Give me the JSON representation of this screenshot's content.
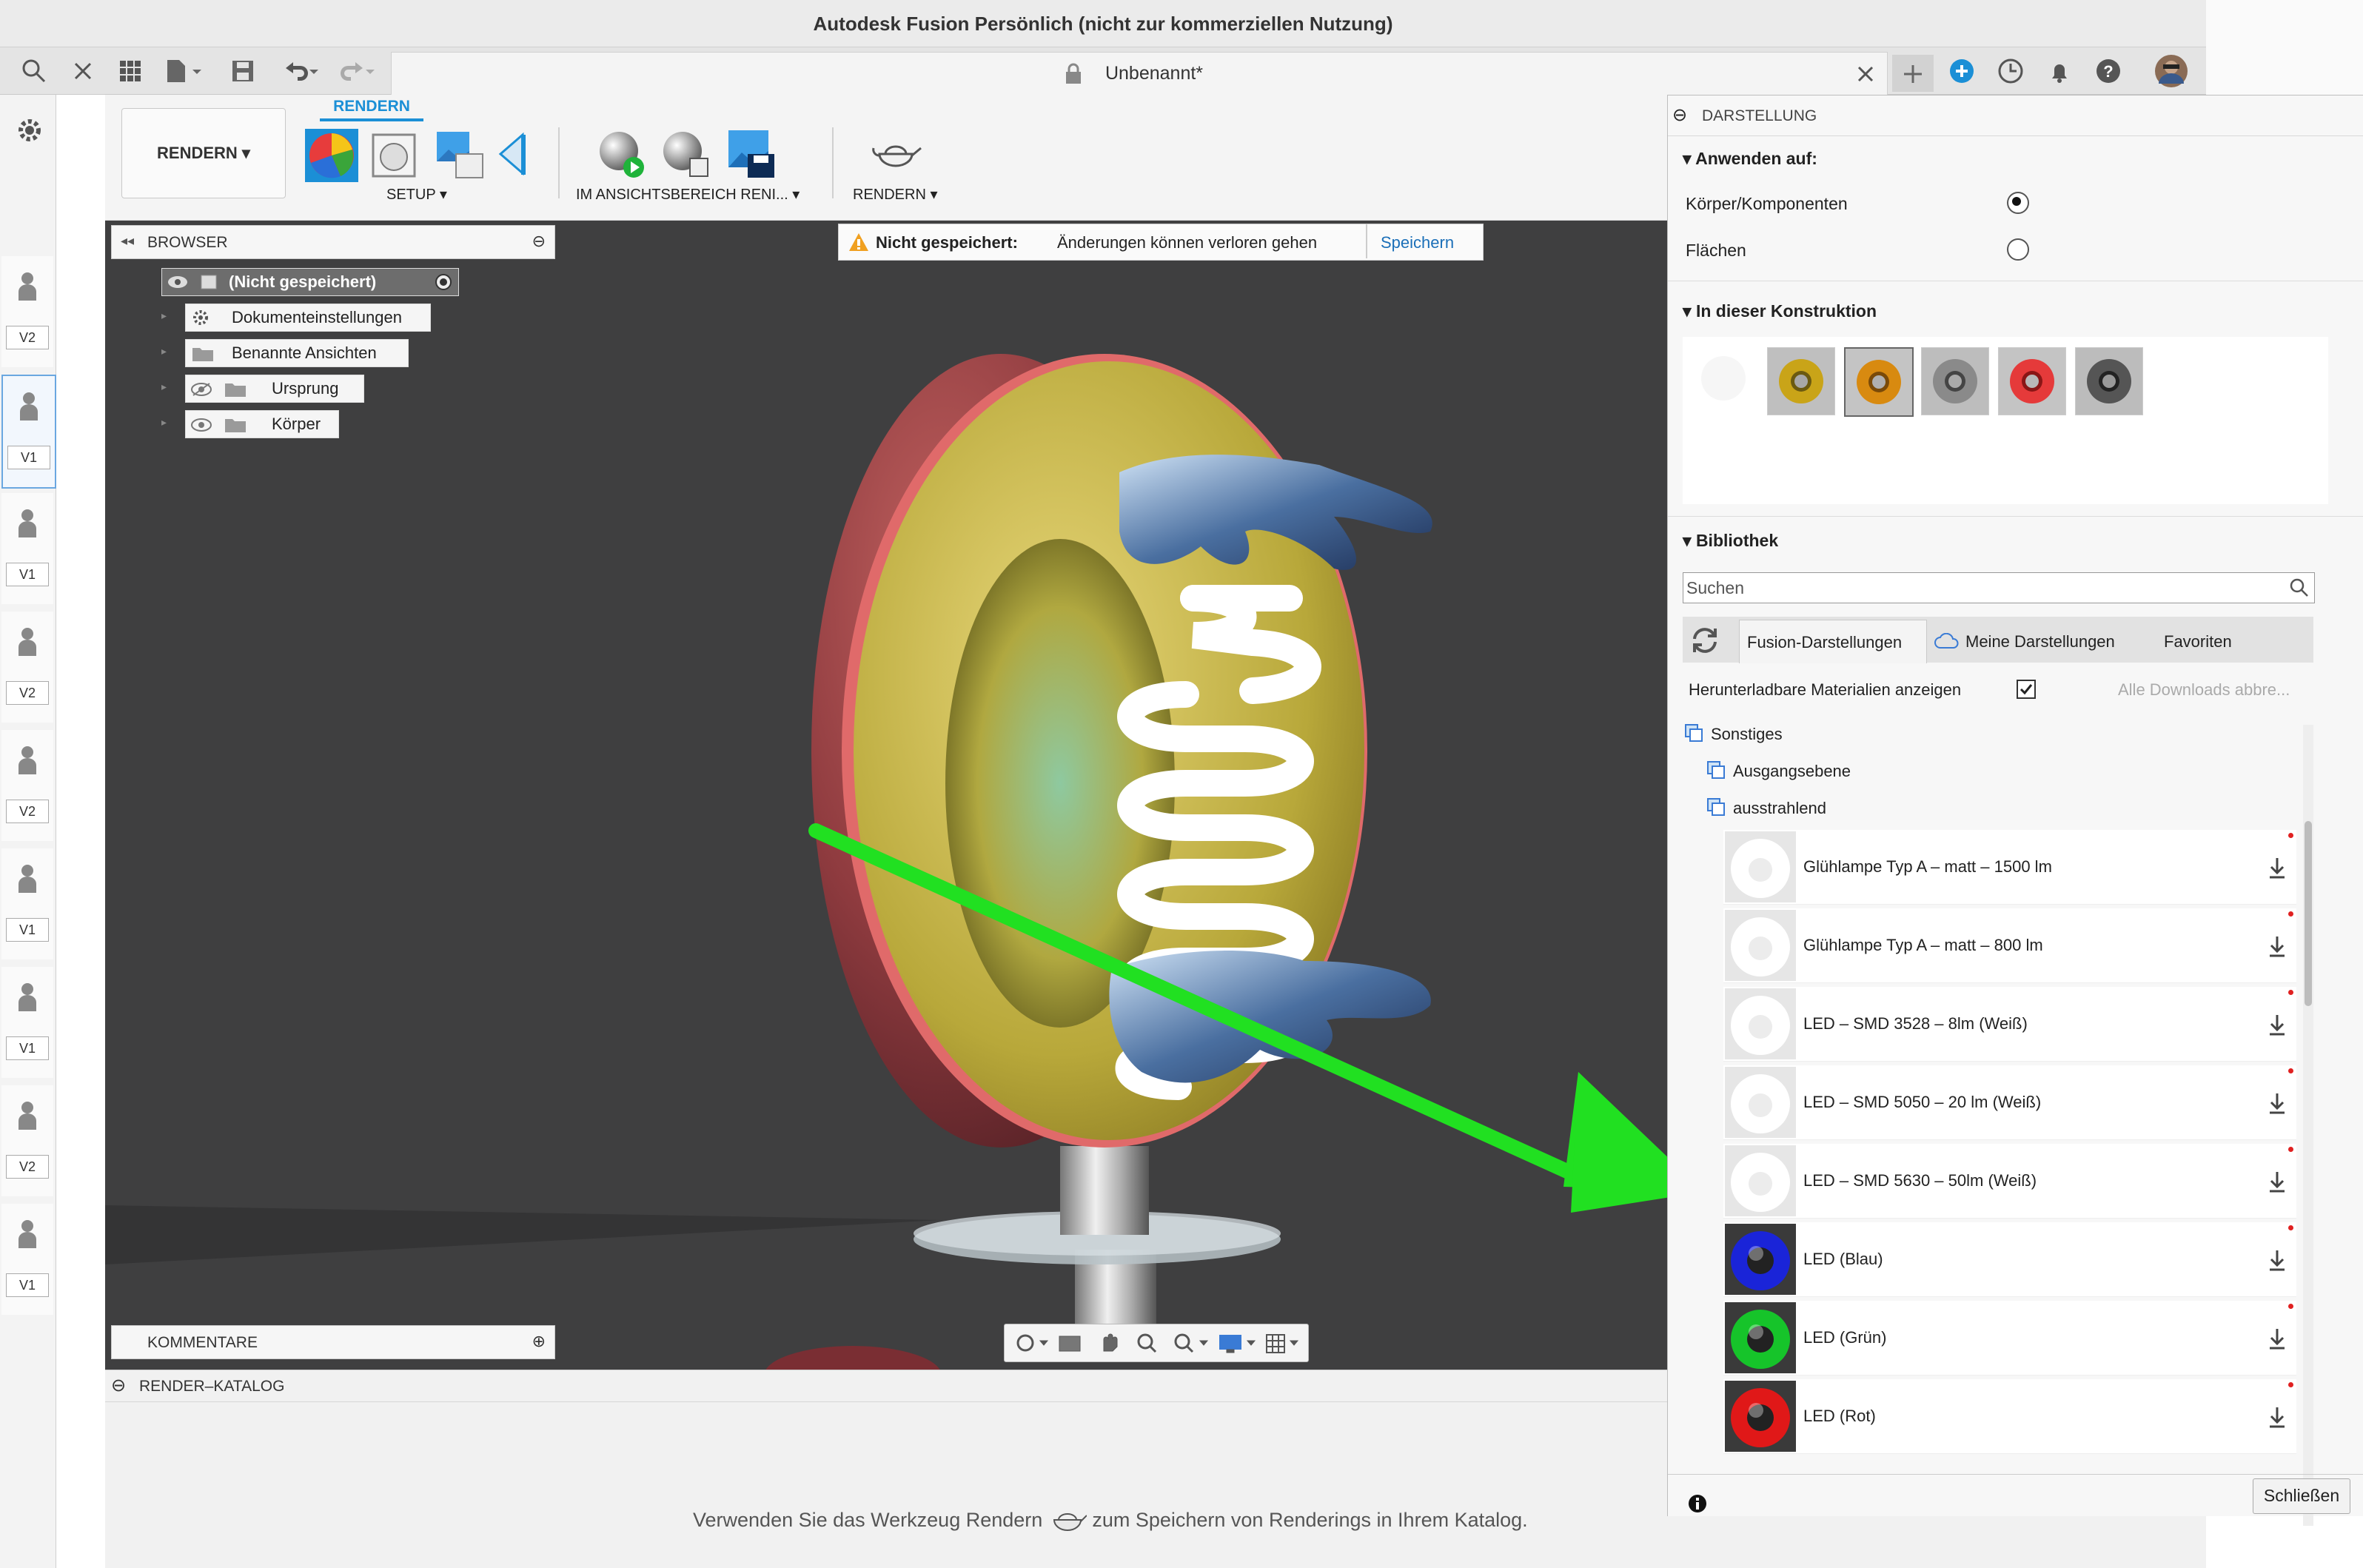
{
  "app": {
    "title": "Autodesk Fusion Persönlich (nicht zur kommerziellen Nutzung)"
  },
  "toolbar": {
    "doc_tab": "Unbenannt*",
    "icons": [
      "search-icon",
      "close-icon",
      "apps-grid-icon",
      "file-icon",
      "save-icon",
      "undo-icon",
      "redo-icon",
      "new-tab-icon",
      "extensions-icon",
      "job-status-icon",
      "notifications-icon",
      "help-icon",
      "user-avatar"
    ]
  },
  "versions": [
    "V2",
    "V1",
    "V1",
    "V2",
    "V2",
    "V1",
    "V1",
    "V2",
    "V1"
  ],
  "ribbon": {
    "workspace": "RENDERN",
    "tab": "RENDERN",
    "groups": {
      "setup": "SETUP",
      "in_canvas": "IM ANSICHTSBEREICH RENI...",
      "render": "RENDERN"
    }
  },
  "browser": {
    "title": "BROWSER",
    "root": "(Nicht gespeichert)",
    "nodes": [
      "Dokumenteinstellungen",
      "Benannte Ansichten",
      "Ursprung",
      "Körper"
    ]
  },
  "warning": {
    "label": "Nicht gespeichert:",
    "message": "Änderungen können verloren gehen",
    "action": "Speichern"
  },
  "comments": {
    "title": "KOMMENTARE"
  },
  "render_catalog": {
    "title": "RENDER–KATALOG",
    "hint_before": "Verwenden Sie das Werkzeug Rendern",
    "hint_after": "zum Speichern von Renderings in Ihrem Katalog."
  },
  "dialog": {
    "title": "DARSTELLUNG",
    "apply_section": "Anwenden auf:",
    "apply_options": [
      {
        "label": "Körper/Komponenten",
        "selected": true
      },
      {
        "label": "Flächen",
        "selected": false
      }
    ],
    "design_section": "In dieser Konstruktion",
    "library_section": "Bibliothek",
    "search_placeholder": "Suchen",
    "tabs": [
      "Fusion-Darstellungen",
      "Meine Darstellungen",
      "Favoriten"
    ],
    "downloadable_label": "Herunterladbare Materialien anzeigen",
    "downloadable_checked": true,
    "cancel_downloads": "Alle Downloads abbre...",
    "tree": {
      "root": "Sonstiges",
      "children": [
        "Ausgangsebene",
        "ausstrahlend"
      ]
    },
    "items": [
      {
        "name": "Glühlampe Typ A – matt – 1500 lm",
        "color": "#ffffff"
      },
      {
        "name": "Glühlampe Typ A – matt – 800 lm",
        "color": "#ffffff"
      },
      {
        "name": "LED – SMD 3528 – 8lm (Weiß)",
        "color": "#ffffff"
      },
      {
        "name": "LED – SMD 5050 – 20 lm (Weiß)",
        "color": "#ffffff"
      },
      {
        "name": "LED – SMD 5630 – 50lm (Weiß)",
        "color": "#ffffff"
      },
      {
        "name": "LED (Blau)",
        "color": "#1a24d8"
      },
      {
        "name": "LED (Grün)",
        "color": "#16c42a"
      },
      {
        "name": "LED (Rot)",
        "color": "#e01818"
      }
    ],
    "close": "Schließen"
  },
  "colors": {
    "accent": "#1b8fd6",
    "viewport_bg": "#3f3f40",
    "arrow": "#21e021"
  }
}
